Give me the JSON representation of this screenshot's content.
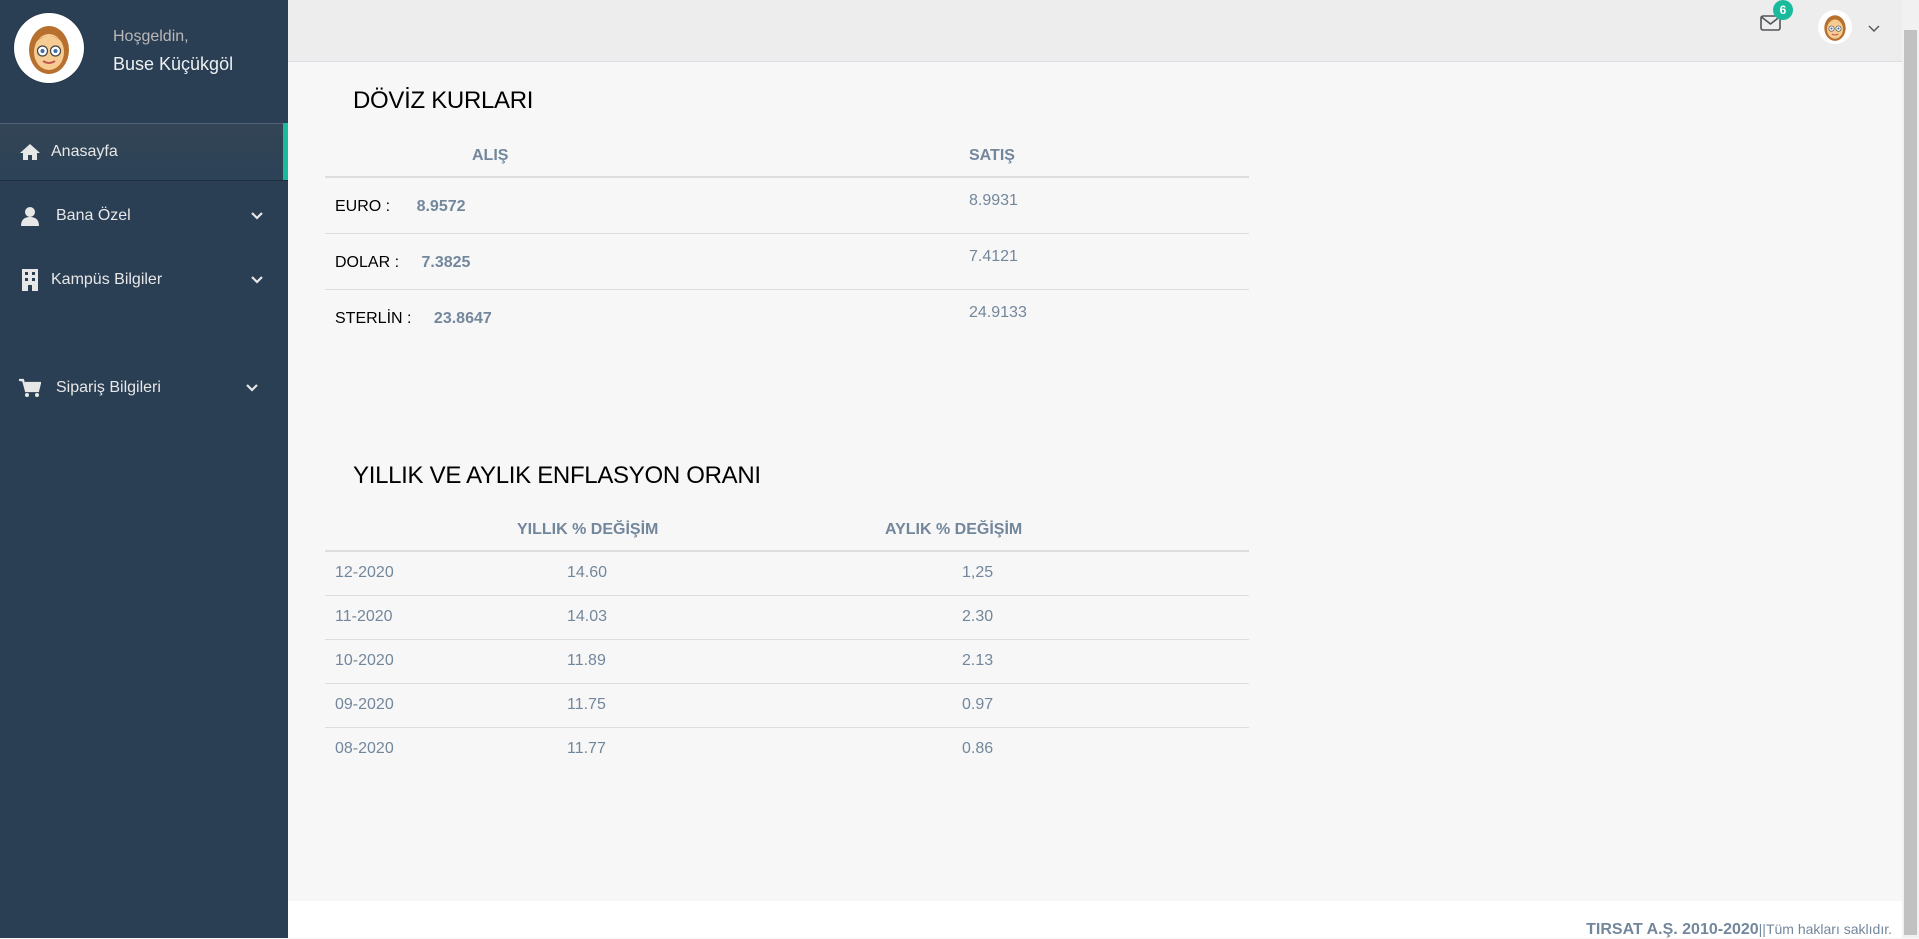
{
  "sidebar": {
    "welcome": "Hoşgeldin,",
    "username": "Buse Küçükgöl",
    "items": [
      {
        "label": "Anasayfa",
        "icon": "home-icon",
        "active": true
      },
      {
        "label": "Bana Özel",
        "icon": "user-icon",
        "has_submenu": true
      },
      {
        "label": "Kampüs Bilgiler",
        "icon": "building-icon",
        "has_submenu": true
      },
      {
        "label": "Sipariş Bilgileri",
        "icon": "cart-icon",
        "has_submenu": true
      }
    ]
  },
  "topnav": {
    "mail_count": "6"
  },
  "exchange": {
    "title": "DÖVİZ KURLARI",
    "col_buy": "ALIŞ",
    "col_sell": "SATIŞ",
    "rows": [
      {
        "label": "EURO :",
        "buy": "8.9572",
        "sell": "8.9931"
      },
      {
        "label": "DOLAR :",
        "buy": "7.3825",
        "sell": "7.4121"
      },
      {
        "label": "STERLİN :",
        "buy": "23.8647",
        "sell": "24.9133"
      }
    ]
  },
  "inflation": {
    "title": "YILLIK VE AYLIK ENFLASYON ORANI",
    "col_yearly": "YILLIK % DEĞİŞİM",
    "col_monthly": "AYLIK % DEĞİŞİM",
    "rows": [
      {
        "period": "12-2020",
        "yearly": "14.60",
        "monthly": "1,25"
      },
      {
        "period": "11-2020",
        "yearly": "14.03",
        "monthly": "2.30"
      },
      {
        "period": "10-2020",
        "yearly": "11.89",
        "monthly": "2.13"
      },
      {
        "period": "09-2020",
        "yearly": "11.75",
        "monthly": "0.97"
      },
      {
        "period": "08-2020",
        "yearly": "11.77",
        "monthly": "0.86"
      }
    ]
  },
  "footer": {
    "company": "TIRSAT A.Ş. 2010-2020",
    "rights": "||Tüm hakları saklıdır."
  },
  "colors": {
    "sidebar_bg": "#2a3f54",
    "accent": "#1abb9c",
    "text_muted": "#73879c"
  }
}
